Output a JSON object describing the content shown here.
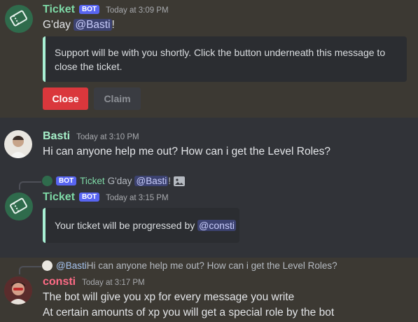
{
  "colors": {
    "background": "#313338",
    "highlight": "#3c3933",
    "ticket_name": "#7ed9a6",
    "basti_name": "#a6f0c9",
    "consti_name": "#ff6b86",
    "close_button": "#da373c",
    "claim_button": "#3a3c42",
    "embed_accent": "#a8f0d4",
    "mention_bg": "#3c4270"
  },
  "messages": [
    {
      "username": "Ticket",
      "badge": "BOT",
      "timestamp": "Today at 3:09 PM",
      "greeting": "G'day ",
      "mention": "@Basti",
      "suffix": "!",
      "embed_text": "Support will be with you shortly. Click the button underneath this message to close the ticket.",
      "close_label": "Close",
      "claim_label": "Claim",
      "avatar_icon": "ticket-icon"
    },
    {
      "username": "Basti",
      "timestamp": "Today at 3:10 PM",
      "text": "Hi can anyone help me out? How can i get the Level Roles?",
      "avatar_icon": "user-avatar"
    },
    {
      "reply": {
        "badge": "BOT",
        "username": "Ticket",
        "greeting": "G'day ",
        "mention": "@Basti",
        "suffix": "!",
        "attachment_icon": "image-icon"
      },
      "username": "Ticket",
      "badge": "BOT",
      "timestamp": "Today at 3:15 PM",
      "embed_prefix": "Your ticket will be progressed by ",
      "embed_mention": "@consti",
      "avatar_icon": "ticket-icon"
    },
    {
      "reply": {
        "mention": "@Basti",
        "text": " Hi can anyone help me out? How can i get the Level Roles?"
      },
      "username": "consti",
      "timestamp": "Today at 3:17 PM",
      "line1": "The bot will give you xp for every message you write",
      "line2": "At certain amounts of xp you will get a special role by the bot",
      "avatar_icon": "user-avatar"
    }
  ]
}
